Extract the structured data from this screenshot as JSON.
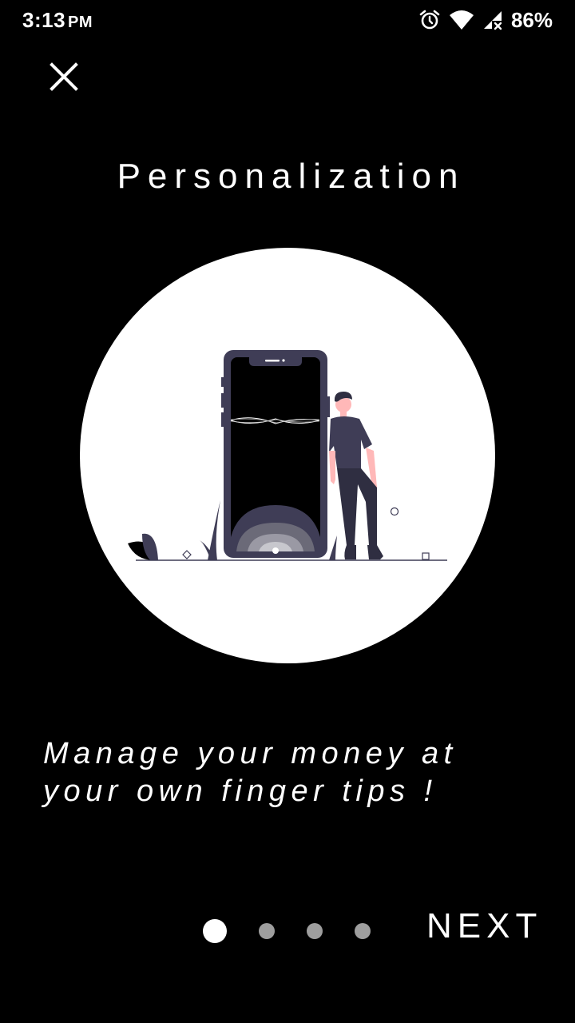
{
  "status_bar": {
    "time": "3:13",
    "ampm": "PM",
    "battery": "86%",
    "icons": [
      "alarm-icon",
      "wifi-icon",
      "signal-icon",
      "battery-icon"
    ]
  },
  "close": {
    "icon": "close-icon"
  },
  "onboarding": {
    "title": "Personalization",
    "tagline_line1": "Manage your money at",
    "tagline_line2": "your own finger tips !",
    "illustration": "person-leaning-on-phone",
    "pages": 4,
    "current_page": 1,
    "next_label": "NEXT"
  },
  "colors": {
    "background": "#000000",
    "text": "#ffffff",
    "accent_purple": "#3f3d56",
    "skin": "#ffb8b8",
    "dot_inactive": "#9e9e9e"
  }
}
